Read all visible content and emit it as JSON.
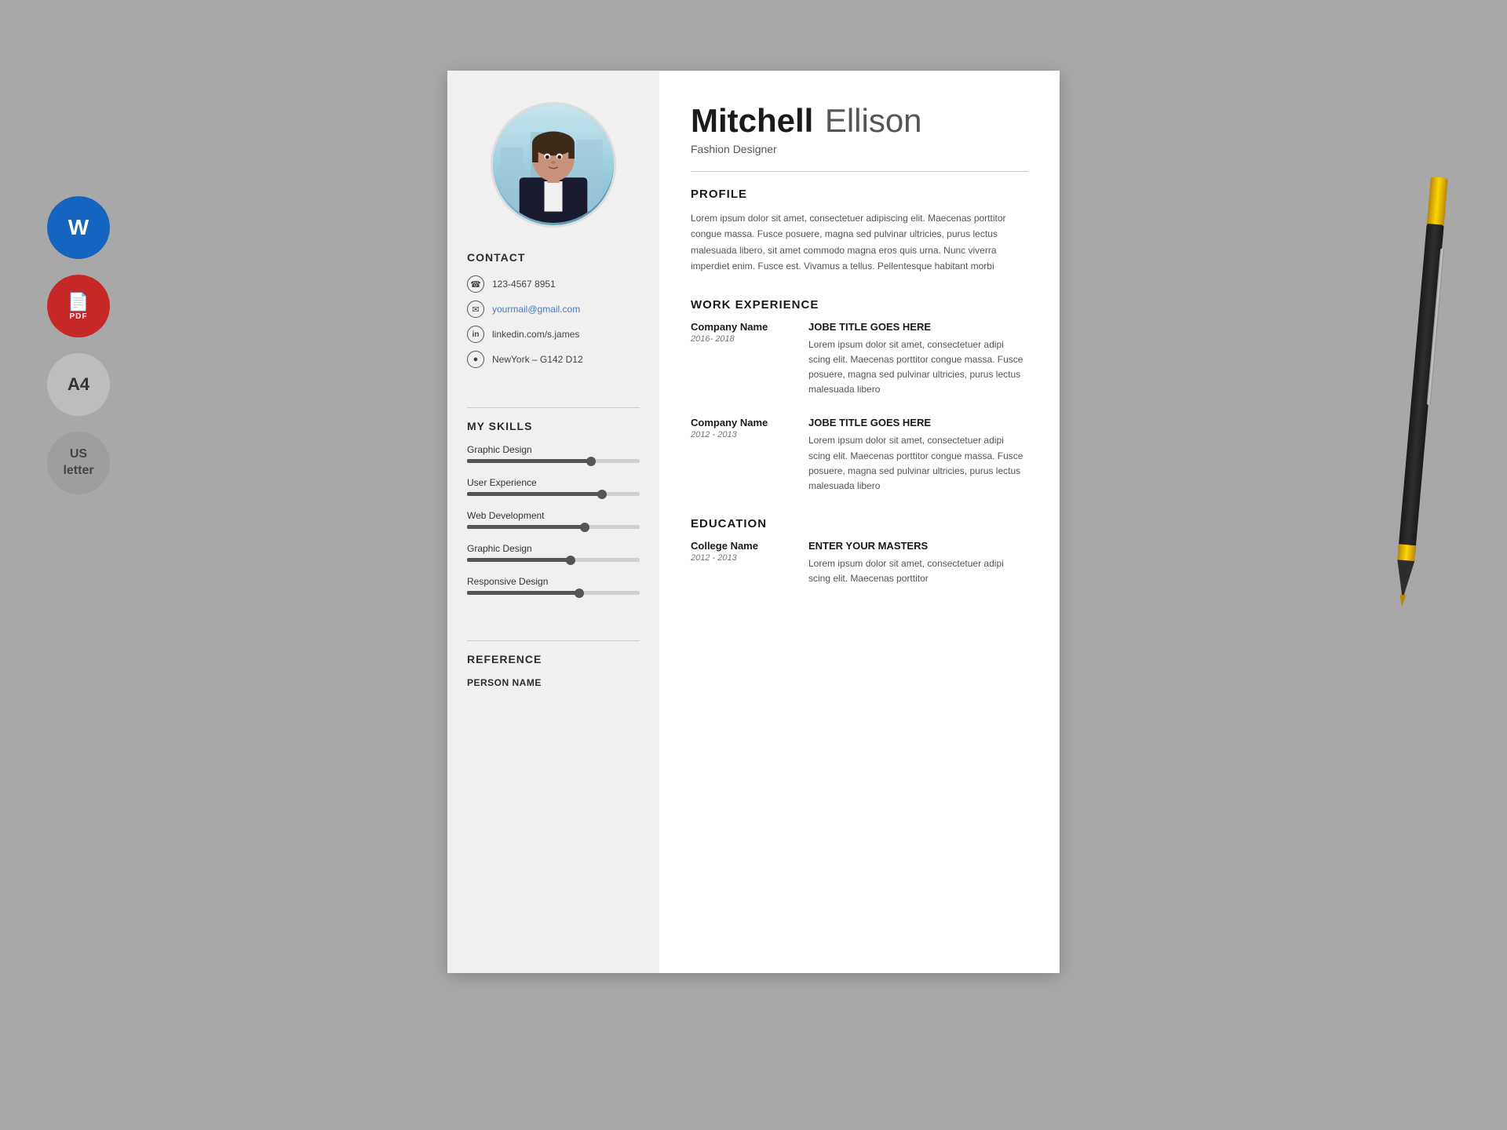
{
  "icons": {
    "word_label": "W",
    "pdf_label": "PDF",
    "a4_label": "A4",
    "us_label": "US\nletter"
  },
  "resume": {
    "name_first": "Mitchell",
    "name_last": "Ellison",
    "job_title": "Fashion Designer",
    "profile_section_title": "PROFILE",
    "profile_text": "Lorem ipsum dolor sit amet, consectetuer adipiscing elit. Maecenas porttitor congue massa. Fusce posuere, magna sed pulvinar ultricies, purus lectus malesuada libero, sit amet commodo magna eros quis urna. Nunc viverra imperdiet enim. Fusce est. Vivamus a tellus. Pellentesque habitant morbi",
    "contact": {
      "section_title": "CONTACT",
      "phone": "123-4567 8951",
      "email": "yourmail@gmail.com",
      "linkedin": "linkedin.com/s.james",
      "address": "NewYork – G142 D12"
    },
    "skills": {
      "section_title": "MY SKILLS",
      "items": [
        {
          "name": "Graphic Design",
          "percent": 72
        },
        {
          "name": "User Experience",
          "percent": 78
        },
        {
          "name": "Web Development",
          "percent": 68
        },
        {
          "name": "Graphic Design",
          "percent": 60
        },
        {
          "name": "Responsive Design",
          "percent": 65
        }
      ]
    },
    "work_experience": {
      "section_title": "WORK EXPERIENCE",
      "entries": [
        {
          "company": "Company Name",
          "dates": "2016- 2018",
          "job_title": "JOBE TITLE GOES HERE",
          "description": "Lorem ipsum dolor sit amet, consectetuer adipi scing elit. Maecenas porttitor congue massa. Fusce posuere, magna sed pulvinar ultricies, purus lectus malesuada libero"
        },
        {
          "company": "Company Name",
          "dates": "2012 - 2013",
          "job_title": "JOBE TITLE GOES HERE",
          "description": "Lorem ipsum dolor sit amet, consectetuer adipi scing elit. Maecenas porttitor congue massa. Fusce posuere, magna sed pulvinar ultricies, purus lectus malesuada libero"
        }
      ]
    },
    "education": {
      "section_title": "EDUCATION",
      "entries": [
        {
          "college": "College Name",
          "dates": "2012 - 2013",
          "degree": "ENTER YOUR MASTERS",
          "description": "Lorem ipsum dolor sit amet, consectetuer adipi scing elit. Maecenas porttitor"
        }
      ]
    },
    "reference": {
      "section_title": "REFERENCE",
      "person_label": "PERSON NAME"
    }
  }
}
